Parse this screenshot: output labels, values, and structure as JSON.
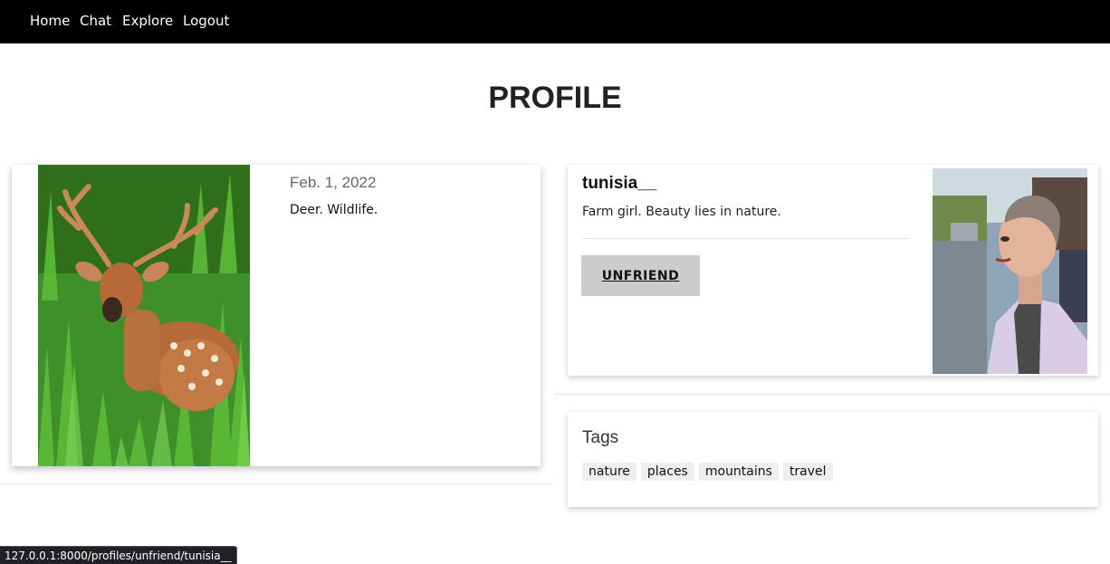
{
  "nav": {
    "links": [
      "Home",
      "Chat",
      "Explore",
      "Logout"
    ]
  },
  "page": {
    "title": "PROFILE"
  },
  "post": {
    "date": "Feb. 1, 2022",
    "caption": "Deer. Wildlife."
  },
  "profile": {
    "username": "tunisia__",
    "bio": "Farm girl. Beauty lies in nature.",
    "unfriend_label": "UNFRIEND"
  },
  "tags": {
    "title": "Tags",
    "items": [
      "nature",
      "places",
      "mountains",
      "travel"
    ]
  },
  "status_bar": {
    "url": "127.0.0.1:8000/profiles/unfriend/tunisia__"
  }
}
